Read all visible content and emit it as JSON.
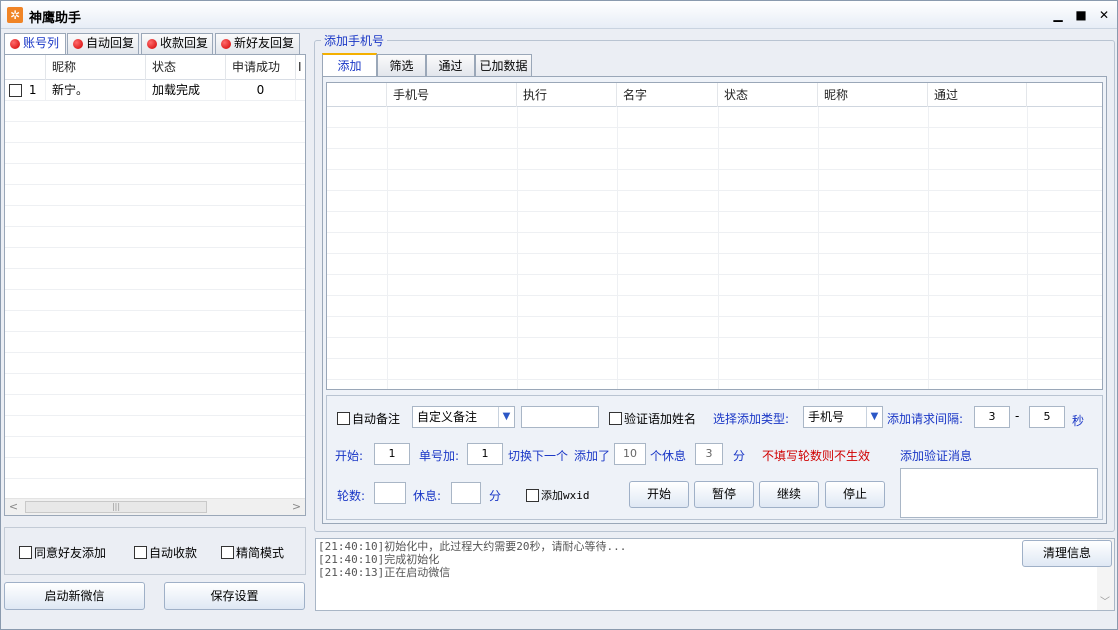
{
  "window": {
    "title": "神鹰助手",
    "app_icon_glyph": "✲",
    "controls": {
      "minimize": "▁",
      "maximize": "■",
      "close": "✕"
    }
  },
  "left_tabs": [
    {
      "label": "账号列",
      "active": true
    },
    {
      "label": "自动回复"
    },
    {
      "label": "收款回复"
    },
    {
      "label": "新好友回复"
    }
  ],
  "account_table": {
    "columns": [
      "昵称",
      "状态",
      "申请成功",
      "I"
    ],
    "rows": [
      {
        "index": "1",
        "nickname": "新宁。",
        "status": "加载完成",
        "success": "0",
        "checked": false
      }
    ]
  },
  "left_options": {
    "agree_friend": "同意好友添加",
    "auto_collect": "自动收款",
    "simple_mode": "精简模式"
  },
  "left_buttons": {
    "start_wechat": "启动新微信",
    "save_settings": "保存设置"
  },
  "group_title": "添加手机号",
  "right_tabs": [
    {
      "label": "添加",
      "active": true
    },
    {
      "label": "筛选"
    },
    {
      "label": "通过"
    },
    {
      "label": "已加数据"
    }
  ],
  "phone_table": {
    "columns": [
      "手机号",
      "执行",
      "名字",
      "状态",
      "昵称",
      "通过"
    ]
  },
  "controls": {
    "auto_remark": "自动备注",
    "remark_select": "自定义备注",
    "remark_input": "",
    "verify_add_name": "验证语加姓名",
    "add_type_label": "选择添加类型:",
    "add_type_value": "手机号",
    "interval_label": "添加请求间隔:",
    "interval_min": "3",
    "interval_dash": "-",
    "interval_max": "5",
    "interval_unit": "秒",
    "start_label": "开始:",
    "start_value": "1",
    "per_number_label": "单号加:",
    "per_number_value": "1",
    "switch_label": "切换下一个",
    "added_label": "添加了",
    "added_value": "10",
    "rest_label": "个休息",
    "rest_value": "3",
    "minute_unit": "分",
    "warning": "不填写轮数则不生效",
    "verify_msg_label": "添加验证消息",
    "rounds_label": "轮数:",
    "rounds_value": "",
    "rest2_label": "休息:",
    "rest2_value": "",
    "rest2_unit": "分",
    "add_wxid": "添加wxid",
    "btn_start": "开始",
    "btn_pause": "暂停",
    "btn_continue": "继续",
    "btn_stop": "停止"
  },
  "log": {
    "lines": [
      "[21:40:10]初始化中，此过程大约需要20秒，请耐心等待...",
      "[21:40:10]完成初始化",
      "[21:40:13]正在启动微信"
    ],
    "clear_button": "清理信息"
  }
}
